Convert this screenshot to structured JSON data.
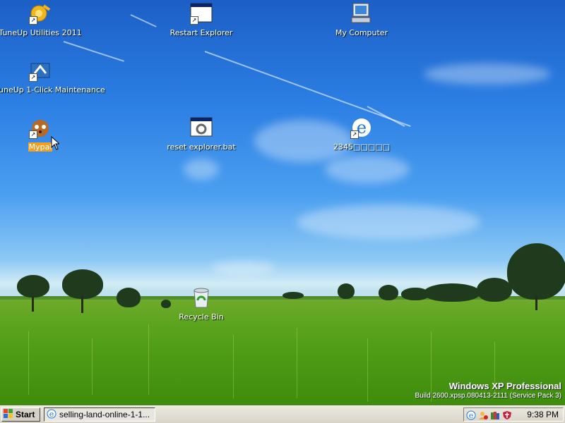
{
  "desktop": {
    "icons": [
      {
        "label": "TuneUp Utilities 2011",
        "icon": "tuneup-utilities-icon"
      },
      {
        "label": "Restart Explorer",
        "icon": "batch-file-icon"
      },
      {
        "label": "My Computer",
        "icon": "my-computer-icon"
      },
      {
        "label": "uneUp 1-Click Maintenance",
        "icon": "tuneup-maintenance-icon"
      },
      {
        "label": "Mypal",
        "icon": "mypal-icon",
        "selected": true
      },
      {
        "label": "reset explorer.bat",
        "icon": "batch-file-icon"
      },
      {
        "label": "2345□□□□□",
        "icon": "ie-browser-icon"
      },
      {
        "label": "Recycle Bin",
        "icon": "recycle-bin-icon"
      }
    ],
    "selection_color": "#f0a020"
  },
  "watermark": {
    "title": "Windows XP Professional",
    "build": "Build 2600.xpsp.080413-2111 (Service Pack 3)"
  },
  "taskbar": {
    "start_label": "Start",
    "task_item_label": "selling-land-online-1-1...",
    "tray_icons": [
      "ie-tray-icon",
      "user-alert-icon",
      "books-icon",
      "shield-icon"
    ],
    "clock": "9:38 PM"
  }
}
